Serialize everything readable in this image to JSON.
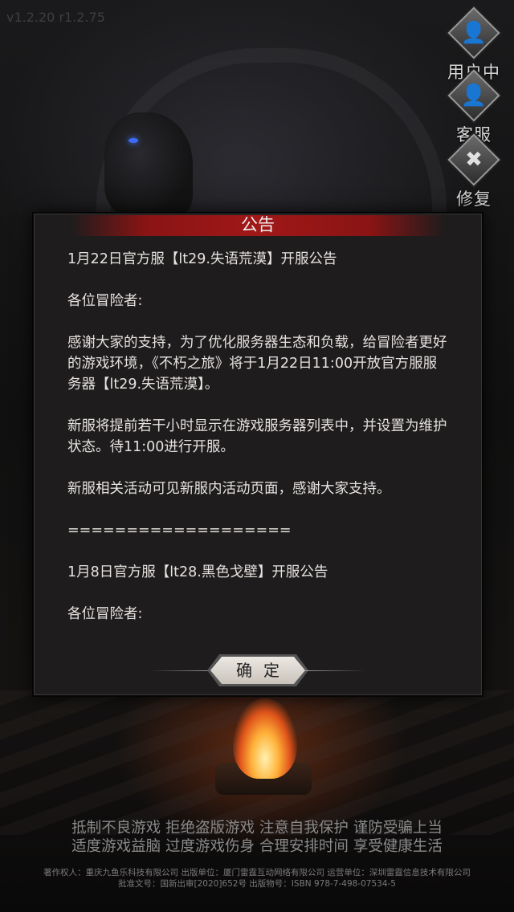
{
  "version": "v1.2.20 r1.2.75",
  "side_menu": [
    {
      "label": "用户中心",
      "icon": "user-center-icon",
      "glyph": "👤"
    },
    {
      "label": "客服",
      "icon": "customer-service-icon",
      "glyph": "👤"
    },
    {
      "label": "修复",
      "icon": "repair-wrench-icon",
      "glyph": "✖"
    }
  ],
  "modal": {
    "title": "公告",
    "paragraphs": [
      "1月22日官方服【lt29.失语荒漠】开服公告",
      "各位冒险者:",
      "感谢大家的支持，为了优化服务器生态和负载，给冒险者更好的游戏环境，《不朽之旅》将于1月22日11:00开放官方服服务器【lt29.失语荒漠】。",
      "新服将提前若干小时显示在游戏服务器列表中，并设置为维护状态。待11:00进行开服。",
      "新服相关活动可见新服内活动页面，感谢大家支持。",
      "===================",
      "1月8日官方服【lt28.黑色戈壁】开服公告",
      "各位冒险者:"
    ],
    "confirm_label": "确定"
  },
  "health_notice": {
    "line1": "抵制不良游戏 拒绝盗版游戏 注意自我保护 谨防受骗上当",
    "line2": "适度游戏益脑 过度游戏伤身 合理安排时间 享受健康生活"
  },
  "legal": {
    "line1": "著作权人：重庆九鱼乐科技有限公司 出版单位：厦门雷霆互动网络有限公司 运营单位：深圳雷霆信息技术有限公司",
    "line2": "批准文号：国新出审[2020]652号 出版物号：ISBN 978-7-498-07534-5"
  }
}
